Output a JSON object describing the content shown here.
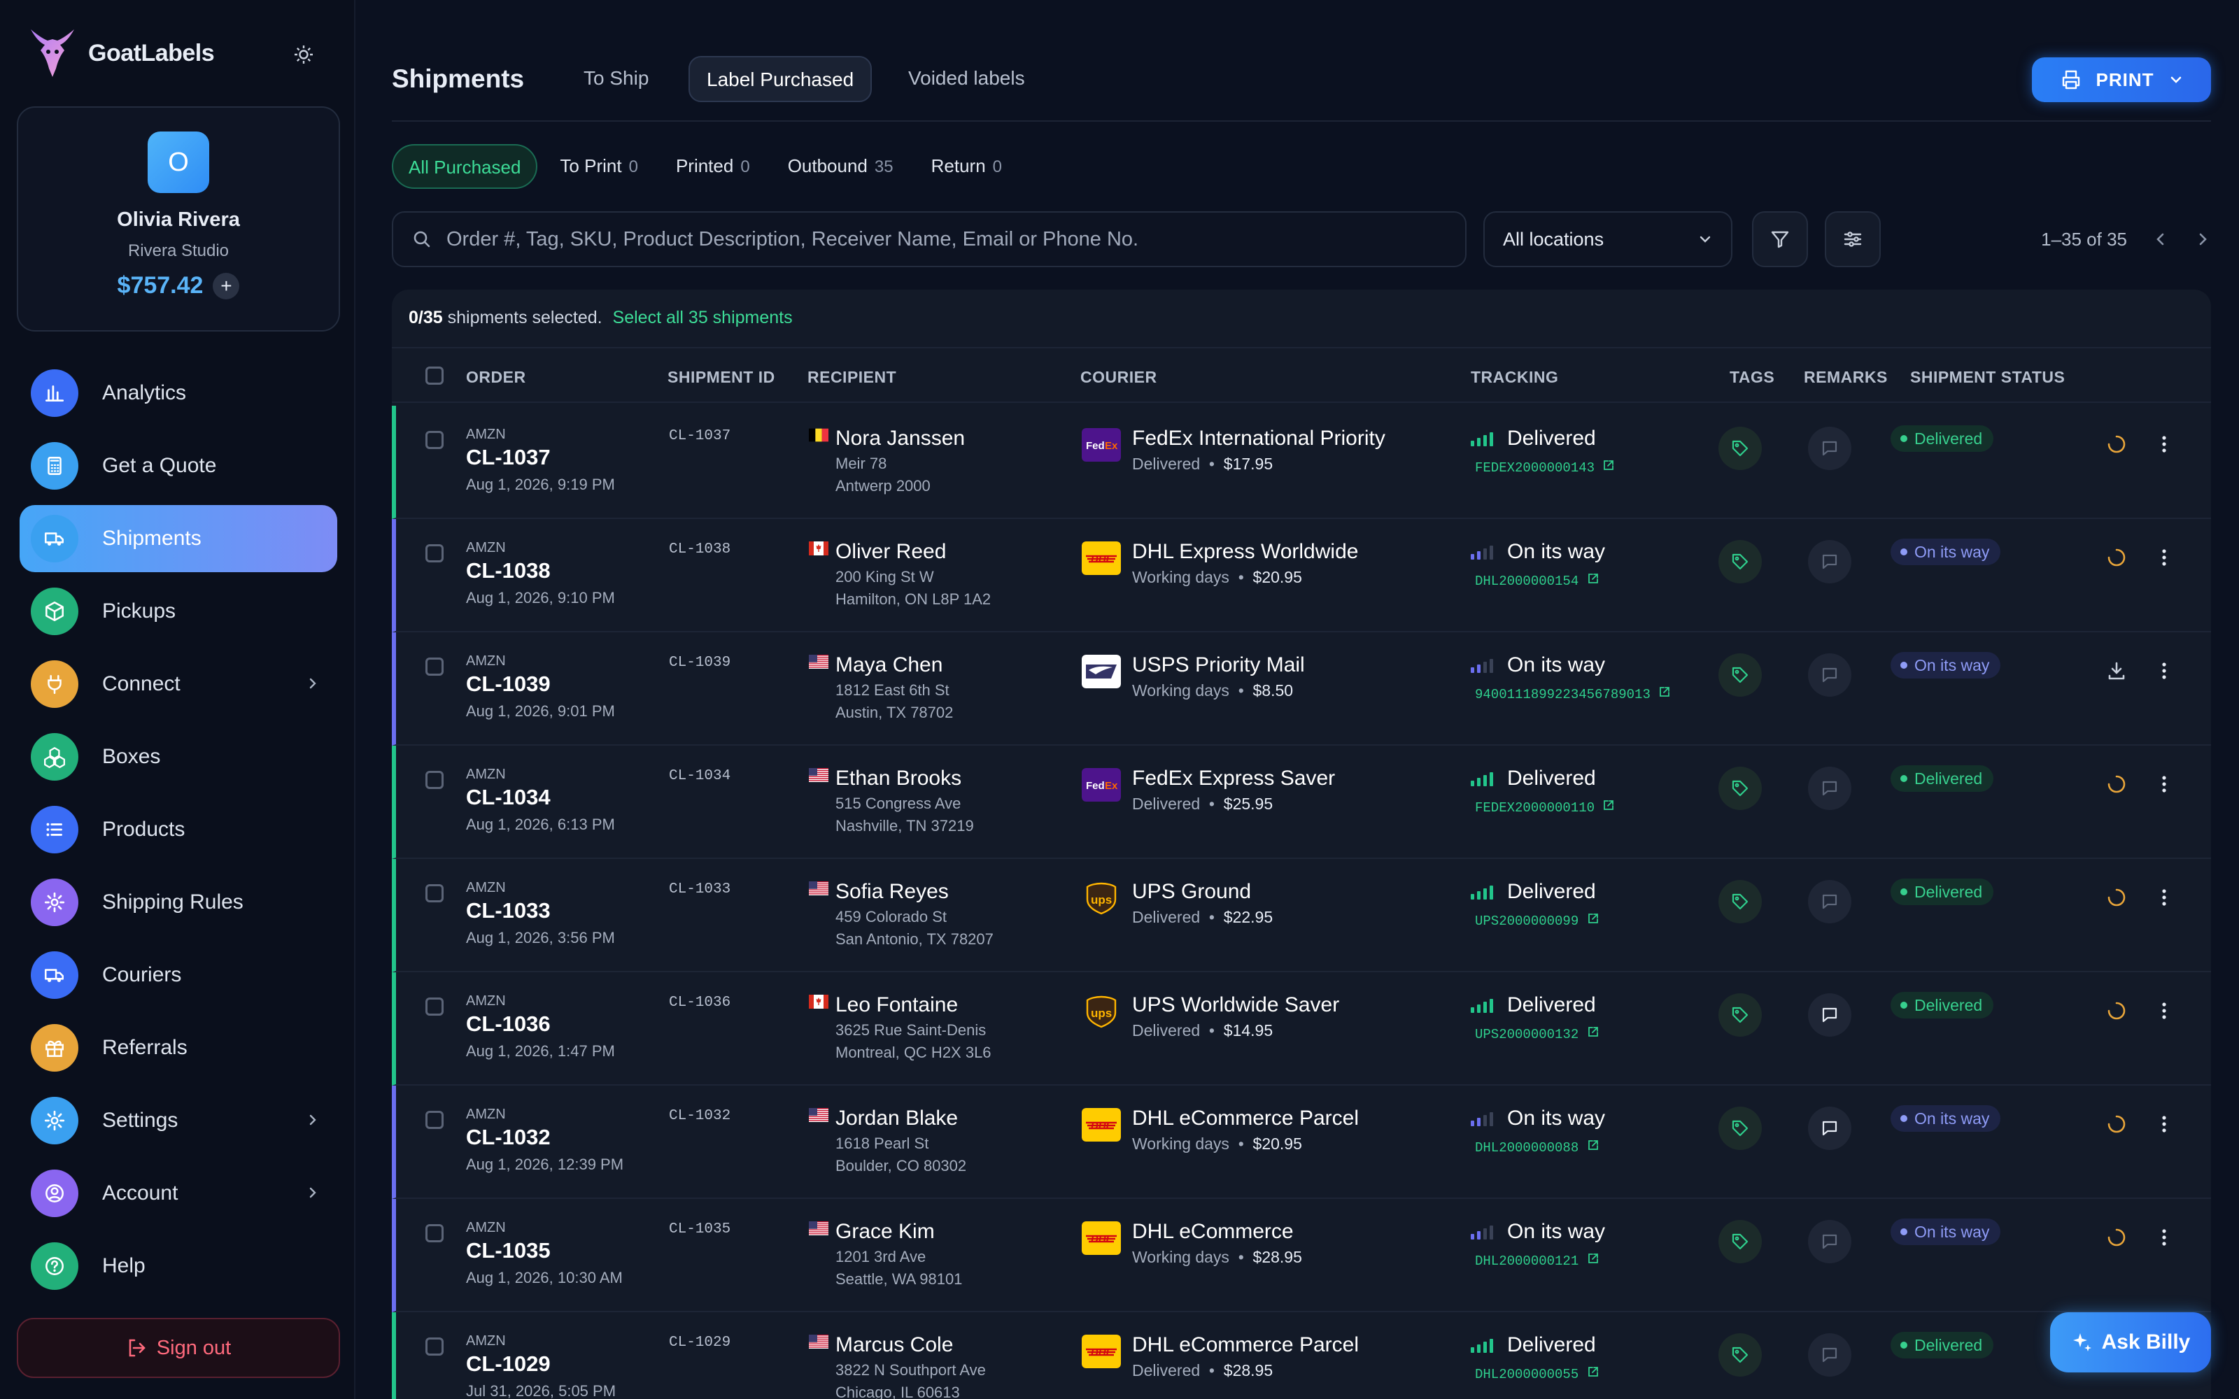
{
  "app": {
    "name": "GoatLabels"
  },
  "profile": {
    "initial": "O",
    "name": "Olivia Rivera",
    "company": "Rivera Studio",
    "balance": "$757.42",
    "add": "+"
  },
  "nav": [
    {
      "label": "Analytics",
      "icon": "chart-icon",
      "color": "#3a6cf5"
    },
    {
      "label": "Get a Quote",
      "icon": "calculator-icon",
      "color": "#3aa0f0"
    },
    {
      "label": "Shipments",
      "icon": "truck-icon",
      "color": "#3aa0f0"
    },
    {
      "label": "Pickups",
      "icon": "box-icon",
      "color": "#22b07a"
    },
    {
      "label": "Connect",
      "icon": "plug-icon",
      "color": "#e8a53a"
    },
    {
      "label": "Boxes",
      "icon": "boxes-icon",
      "color": "#22b07a"
    },
    {
      "label": "Products",
      "icon": "list-icon",
      "color": "#3a6cf5"
    },
    {
      "label": "Shipping Rules",
      "icon": "gear-icon",
      "color": "#8a66f0"
    },
    {
      "label": "Couriers",
      "icon": "truck-icon",
      "color": "#3a6cf5"
    },
    {
      "label": "Referrals",
      "icon": "gift-icon",
      "color": "#e8a53a"
    },
    {
      "label": "Settings",
      "icon": "gear-icon",
      "color": "#3aa0f0"
    },
    {
      "label": "Account",
      "icon": "user-icon",
      "color": "#8a66f0"
    },
    {
      "label": "Help",
      "icon": "help-icon",
      "color": "#22b07a"
    }
  ],
  "signout": "Sign out",
  "header": {
    "title": "Shipments",
    "tabs": [
      "To Ship",
      "Label Purchased",
      "Voided labels"
    ],
    "print": "PRINT"
  },
  "subtabs": [
    {
      "label": "All Purchased",
      "count": ""
    },
    {
      "label": "To Print",
      "count": "0"
    },
    {
      "label": "Printed",
      "count": "0"
    },
    {
      "label": "Outbound",
      "count": "35"
    },
    {
      "label": "Return",
      "count": "0"
    }
  ],
  "search": {
    "placeholder": "Order #, Tag, SKU, Product Description, Receiver Name, Email or Phone No."
  },
  "location": "All locations",
  "pager": "1–35 of 35",
  "selection": {
    "count": "0/35",
    "text": "shipments selected.",
    "select_all": "Select all 35 shipments"
  },
  "columns": {
    "order": "ORDER",
    "sid": "SHIPMENT ID",
    "recipient": "RECIPIENT",
    "courier": "COURIER",
    "tracking": "TRACKING",
    "tags": "TAGS",
    "remarks": "REMARKS",
    "status": "SHIPMENT STATUS"
  },
  "rows": [
    {
      "mkt": "AMZN",
      "order": "CL-1037",
      "date": "Aug 1, 2026, 9:19 PM",
      "sid": "CL-1037",
      "flag": "be",
      "name": "Nora Janssen",
      "a1": "Meir 78",
      "a2": "Antwerp 2000",
      "courier": "fedex",
      "cname": "FedEx International Priority",
      "cmeta": "Delivered",
      "price": "$17.95",
      "tstatus": "Delivered",
      "tnum": "FEDEX2000000143",
      "status": "Delivered",
      "action": "spin"
    },
    {
      "mkt": "AMZN",
      "order": "CL-1038",
      "date": "Aug 1, 2026, 9:10 PM",
      "sid": "CL-1038",
      "flag": "ca",
      "name": "Oliver Reed",
      "a1": "200 King St W",
      "a2": "Hamilton, ON L8P 1A2",
      "courier": "dhl",
      "cname": "DHL Express Worldwide",
      "cmeta": "Working days",
      "price": "$20.95",
      "tstatus": "On its way",
      "tnum": "DHL2000000154",
      "status": "On its way",
      "action": "spin"
    },
    {
      "mkt": "AMZN",
      "order": "CL-1039",
      "date": "Aug 1, 2026, 9:01 PM",
      "sid": "CL-1039",
      "flag": "us",
      "name": "Maya Chen",
      "a1": "1812 East 6th St",
      "a2": "Austin, TX 78702",
      "courier": "usps",
      "cname": "USPS Priority Mail",
      "cmeta": "Working days",
      "price": "$8.50",
      "tstatus": "On its way",
      "tnum": "9400111899223456789013",
      "status": "On its way",
      "action": "download"
    },
    {
      "mkt": "AMZN",
      "order": "CL-1034",
      "date": "Aug 1, 2026, 6:13 PM",
      "sid": "CL-1034",
      "flag": "us",
      "name": "Ethan Brooks",
      "a1": "515 Congress Ave",
      "a2": "Nashville, TN 37219",
      "courier": "fedex",
      "cname": "FedEx Express Saver",
      "cmeta": "Delivered",
      "price": "$25.95",
      "tstatus": "Delivered",
      "tnum": "FEDEX2000000110",
      "status": "Delivered",
      "action": "spin"
    },
    {
      "mkt": "AMZN",
      "order": "CL-1033",
      "date": "Aug 1, 2026, 3:56 PM",
      "sid": "CL-1033",
      "flag": "us",
      "name": "Sofia Reyes",
      "a1": "459 Colorado St",
      "a2": "San Antonio, TX 78207",
      "courier": "ups",
      "cname": "UPS Ground",
      "cmeta": "Delivered",
      "price": "$22.95",
      "tstatus": "Delivered",
      "tnum": "UPS2000000099",
      "status": "Delivered",
      "action": "spin"
    },
    {
      "mkt": "AMZN",
      "order": "CL-1036",
      "date": "Aug 1, 2026, 1:47 PM",
      "sid": "CL-1036",
      "flag": "ca",
      "name": "Leo Fontaine",
      "a1": "3625 Rue Saint-Denis",
      "a2": "Montreal, QC H2X 3L6",
      "courier": "ups",
      "cname": "UPS Worldwide Saver",
      "cmeta": "Delivered",
      "price": "$14.95",
      "tstatus": "Delivered",
      "tnum": "UPS2000000132",
      "status": "Delivered",
      "action": "spin"
    },
    {
      "mkt": "AMZN",
      "order": "CL-1032",
      "date": "Aug 1, 2026, 12:39 PM",
      "sid": "CL-1032",
      "flag": "us",
      "name": "Jordan Blake",
      "a1": "1618 Pearl St",
      "a2": "Boulder, CO 80302",
      "courier": "dhl",
      "cname": "DHL eCommerce Parcel",
      "cmeta": "Working days",
      "price": "$20.95",
      "tstatus": "On its way",
      "tnum": "DHL2000000088",
      "status": "On its way",
      "action": "spin"
    },
    {
      "mkt": "AMZN",
      "order": "CL-1035",
      "date": "Aug 1, 2026, 10:30 AM",
      "sid": "CL-1035",
      "flag": "us",
      "name": "Grace Kim",
      "a1": "1201 3rd Ave",
      "a2": "Seattle, WA 98101",
      "courier": "dhl",
      "cname": "DHL eCommerce",
      "cmeta": "Working days",
      "price": "$28.95",
      "tstatus": "On its way",
      "tnum": "DHL2000000121",
      "status": "On its way",
      "action": "spin"
    },
    {
      "mkt": "AMZN",
      "order": "CL-1029",
      "date": "Jul 31, 2026, 5:05 PM",
      "sid": "CL-1029",
      "flag": "us",
      "name": "Marcus Cole",
      "a1": "3822 N Southport Ave",
      "a2": "Chicago, IL 60613",
      "courier": "dhl",
      "cname": "DHL eCommerce Parcel",
      "cmeta": "Delivered",
      "price": "$28.95",
      "tstatus": "Delivered",
      "tnum": "DHL2000000055",
      "status": "Delivered",
      "action": "none"
    }
  ],
  "ask": "Ask Billy",
  "colors": {
    "green": "#22c58b",
    "blue": "#6b6ff0",
    "accent": "#2a7ef5"
  }
}
